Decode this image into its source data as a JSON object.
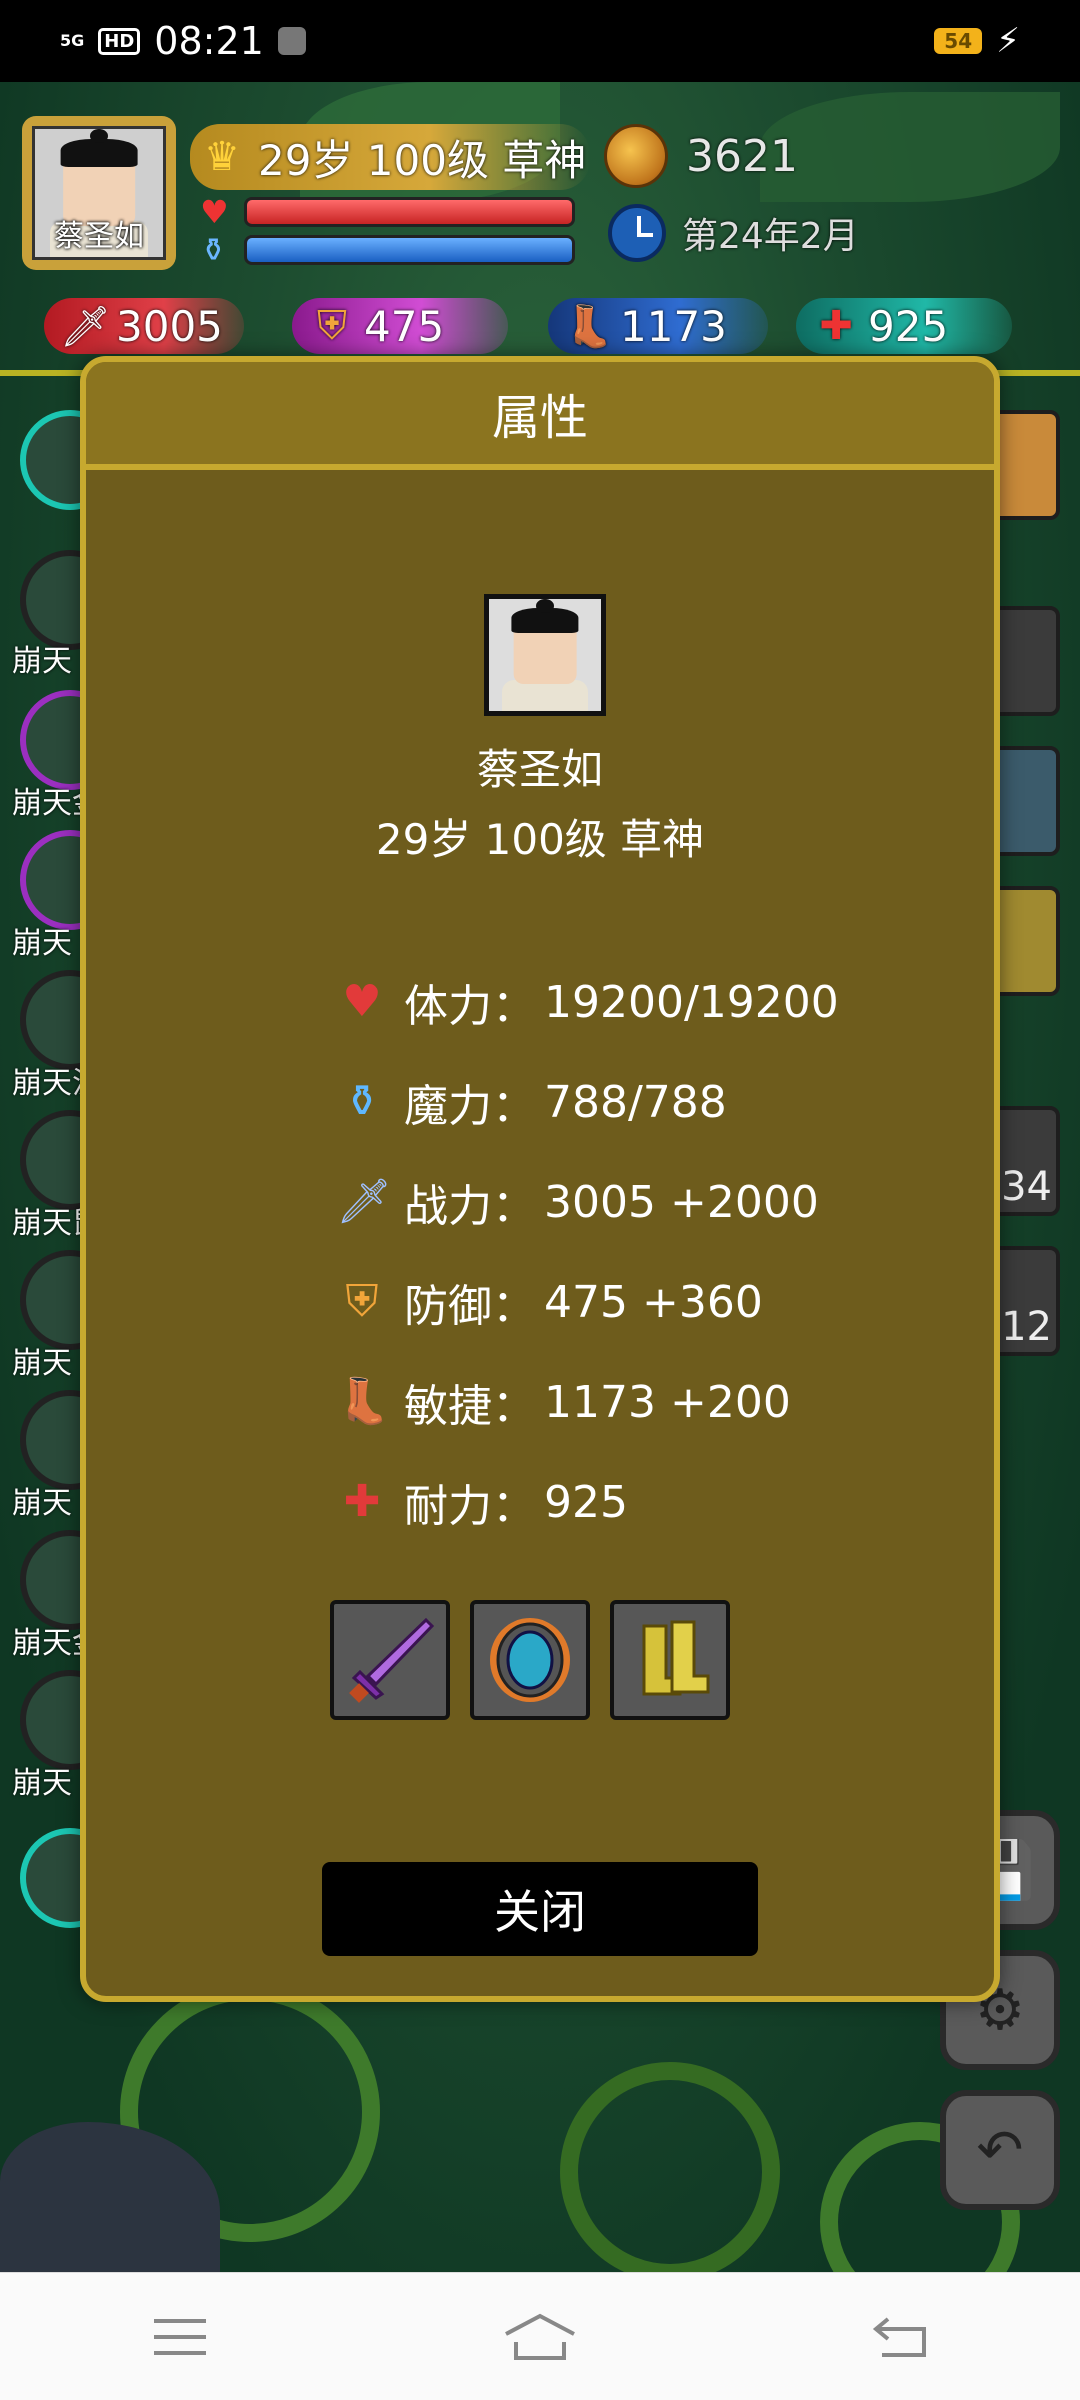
{
  "status_bar": {
    "network": "5G",
    "hd": "HD",
    "time": "08:21",
    "battery": "54"
  },
  "hud": {
    "avatar_name": "蔡圣如",
    "title": "29岁 100级 草神",
    "coins": "3621",
    "date": "第24年2月",
    "hp_level": 1.0,
    "mp_level": 1.0,
    "stats": {
      "attack": "3005",
      "defense": "475",
      "agility": "1173",
      "endurance": "925"
    }
  },
  "side_labels": [
    "崩天",
    "崩天金",
    "崩天",
    "崩天汶",
    "崩天鼠",
    "崩天",
    "崩天",
    "崩天金",
    "崩天"
  ],
  "right_counts": [
    "34",
    "12"
  ],
  "modal": {
    "header": "属性",
    "name": "蔡圣如",
    "subtitle": "29岁 100级 草神",
    "attributes": [
      {
        "icon": "heart-icon",
        "label": "体力：",
        "value": "19200/19200"
      },
      {
        "icon": "potion-icon",
        "label": "魔力：",
        "value": "788/788"
      },
      {
        "icon": "sword-icon",
        "label": "战力：",
        "value": "3005 +2000"
      },
      {
        "icon": "shield-icon",
        "label": "防御：",
        "value": "475 +360"
      },
      {
        "icon": "boot-icon",
        "label": "敏捷：",
        "value": "1173 +200"
      },
      {
        "icon": "heart-plus-icon",
        "label": "耐力：",
        "value": "925"
      }
    ],
    "equipment": [
      "purple-sword-icon",
      "blue-shield-icon",
      "yellow-boots-icon"
    ],
    "close_label": "关闭"
  },
  "colors": {
    "modal_bg": "#6e5c1c",
    "modal_border": "#c7a92f",
    "modal_header": "#8b741f",
    "hud_line": "#b9b323"
  }
}
